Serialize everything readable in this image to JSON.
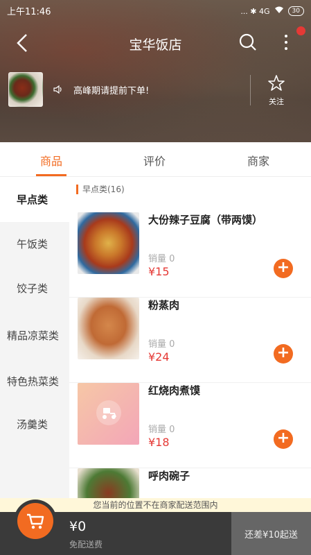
{
  "status_bar": {
    "time": "上午11:46",
    "indicators": "... ✱ 4G",
    "battery": "30"
  },
  "header": {
    "title": "宝华饭店",
    "notice": "高峰期请提前下单!",
    "follow_label": "关注",
    "icons": {
      "back": "back-arrow-icon",
      "search": "search-icon",
      "more": "more-vertical-icon",
      "notice": "speaker-icon",
      "follow": "star-icon"
    }
  },
  "tabs": [
    {
      "label": "商品",
      "active": true
    },
    {
      "label": "评价",
      "active": false
    },
    {
      "label": "商家",
      "active": false
    }
  ],
  "categories": [
    {
      "label": "早点类",
      "active": true
    },
    {
      "label": "午饭类",
      "active": false
    },
    {
      "label": "饺子类",
      "active": false
    },
    {
      "label": "精品凉菜类",
      "active": false
    },
    {
      "label": "特色热菜类",
      "active": false
    },
    {
      "label": "汤羹类",
      "active": false
    }
  ],
  "section_title": "早点类(16)",
  "items": [
    {
      "name": "大份辣子豆腐（带两馍）",
      "sales": "销量 0",
      "price": "¥15"
    },
    {
      "name": "粉蒸肉",
      "sales": "销量 0",
      "price": "¥24"
    },
    {
      "name": "红烧肉煮馍",
      "sales": "销量 0",
      "price": "¥18"
    },
    {
      "name": "呼肉碗子",
      "sales": "",
      "price": ""
    }
  ],
  "warning": "您当前的位置不在商家配送范围内",
  "cart": {
    "total": "¥0",
    "delivery": "免配送费",
    "min_order": "还差¥10起送",
    "icon": "cart-icon"
  },
  "colors": {
    "accent": "#f26b21",
    "price": "#e53935",
    "bottom_bar": "#3a3a3a"
  }
}
